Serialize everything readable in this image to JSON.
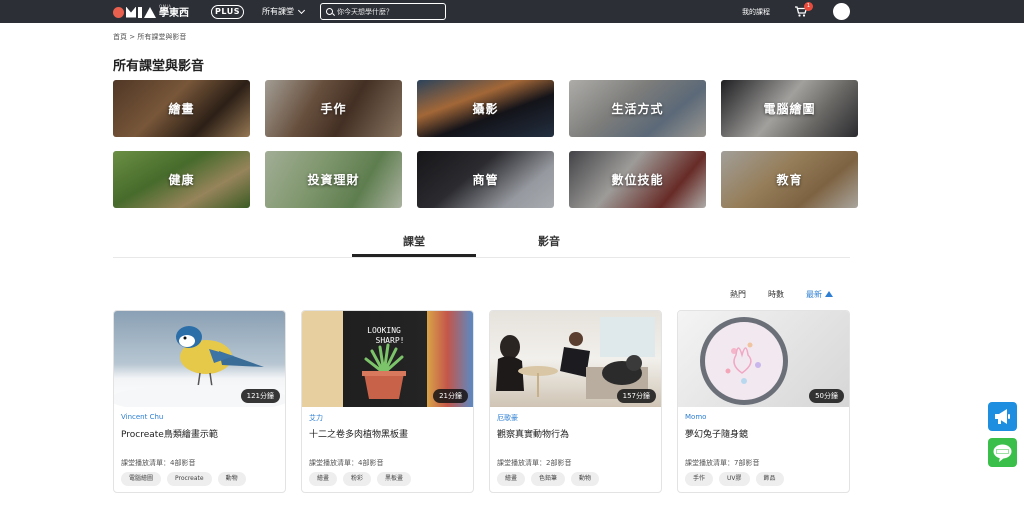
{
  "header": {
    "logo_small": "OMIA",
    "logo_cn": "學東西",
    "plus_label": "PLUS",
    "all_courses_label": "所有課堂",
    "search_placeholder": "你今天想學什麼？",
    "my_courses_label": "我的課程",
    "cart_count": "1"
  },
  "breadcrumb": "首頁 > 所有課堂與影音",
  "page_title": "所有課堂與影音",
  "categories": [
    {
      "label": "繪畫"
    },
    {
      "label": "手作"
    },
    {
      "label": "攝影"
    },
    {
      "label": "生活方式"
    },
    {
      "label": "電腦繪圖"
    },
    {
      "label": "健康"
    },
    {
      "label": "投資理財"
    },
    {
      "label": "商管"
    },
    {
      "label": "數位技能"
    },
    {
      "label": "教育"
    }
  ],
  "tabs": [
    {
      "label": "課堂"
    },
    {
      "label": "影音"
    }
  ],
  "sort": {
    "popular": "熱門",
    "trending": "時數",
    "newest": "最新"
  },
  "courses": [
    {
      "duration": "121分鐘",
      "teacher": "Vincent Chu",
      "title": "Procreate鳥類繪畫示範",
      "playlist": "課堂播放清單：4部影音",
      "tags": [
        "電腦繪圖",
        "Procreate",
        "動物"
      ]
    },
    {
      "duration": "21分鐘",
      "teacher": "艾力",
      "title": "十二之卷多肉植物黑板畫",
      "playlist": "課堂播放清單：4部影音",
      "tags": [
        "繪畫",
        "粉彩",
        "黑板畫"
      ]
    },
    {
      "duration": "157分鐘",
      "teacher": "厄歌豪",
      "title": "觀察真實動物行為",
      "playlist": "課堂播放清單：2部影音",
      "tags": [
        "繪畫",
        "色鉛筆",
        "動物"
      ]
    },
    {
      "duration": "50分鐘",
      "teacher": "Momo",
      "title": "夢幻兔子隨身鏡",
      "playlist": "課堂播放清單：7部影音",
      "tags": [
        "手作",
        "UV膠",
        "飾品"
      ]
    }
  ],
  "colors": {
    "accent": "#2d7fd3",
    "nav_bg": "#2c2f36",
    "line_green": "#3ac04a",
    "announce_blue": "#1e8fe0"
  }
}
